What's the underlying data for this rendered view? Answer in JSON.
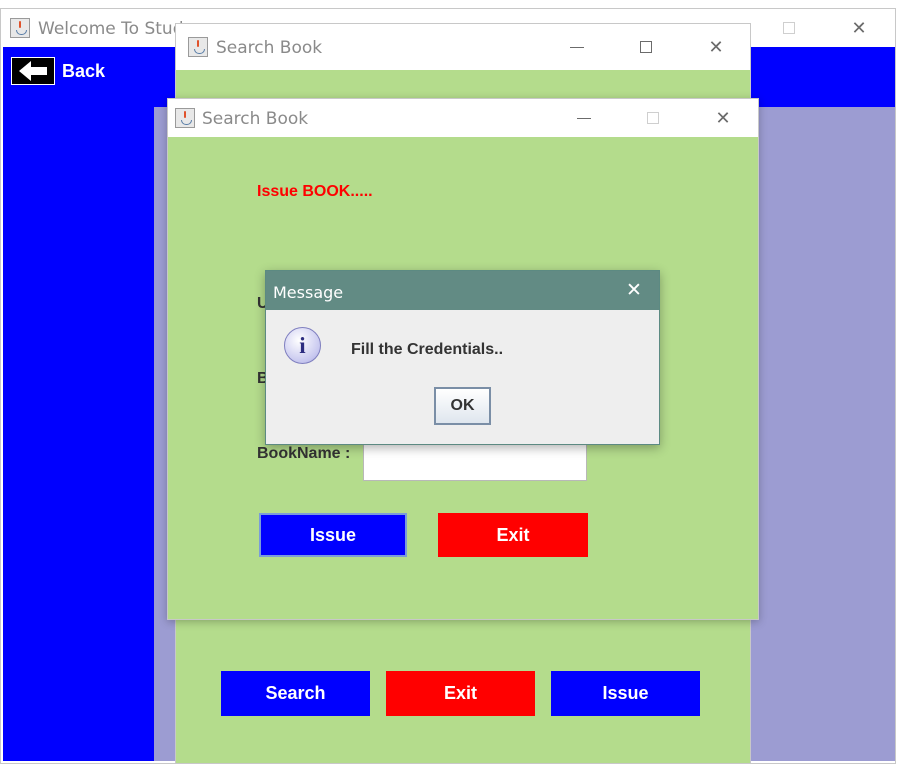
{
  "main_window": {
    "title": "Welcome To Stud",
    "back_label": "Back",
    "colors": {
      "header": "#0000ff",
      "sidebar": "#0000ff",
      "content": "#9c9cd2"
    }
  },
  "search_window": {
    "title": "Search Book",
    "buttons": {
      "search": "Search",
      "exit": "Exit",
      "issue": "Issue"
    },
    "colors": {
      "background": "#b4dc8c"
    }
  },
  "issue_window": {
    "title": "Search Book",
    "heading": "Issue BOOK.....",
    "labels": {
      "user_partial": "U",
      "book_partial": "B",
      "book_name": "BookName :"
    },
    "book_name_value": "",
    "buttons": {
      "issue": "Issue",
      "exit": "Exit"
    }
  },
  "message_dialog": {
    "title": "Message",
    "message": "Fill the Credentials..",
    "ok_label": "OK",
    "icon": "info-icon"
  }
}
